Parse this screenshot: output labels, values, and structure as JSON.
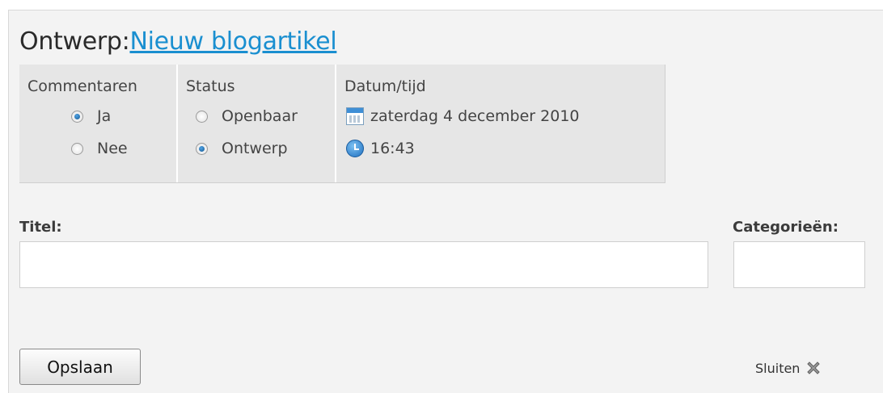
{
  "heading": {
    "prefix": "Ontwerp:",
    "link": "Nieuw blogartikel"
  },
  "options": {
    "comments": {
      "title": "Commentaren",
      "yes": "Ja",
      "no": "Nee",
      "selected": "Ja"
    },
    "status": {
      "title": "Status",
      "public": "Openbaar",
      "draft": "Ontwerp",
      "selected": "Ontwerp"
    },
    "datetime": {
      "title": "Datum/tijd",
      "date": "zaterdag 4 december 2010",
      "time": "16:43"
    }
  },
  "form": {
    "title_label": "Titel:",
    "title_value": "",
    "categories_label": "Categorieën:",
    "categories_value": ""
  },
  "actions": {
    "save": "Opslaan",
    "close": "Sluiten"
  },
  "icons": {
    "calendar": "calendar-icon",
    "clock": "clock-icon",
    "close": "close-icon"
  },
  "colors": {
    "link": "#1a8fd0",
    "panel": "#f3f3f3",
    "option_box": "#e6e6e6",
    "radio_checked": "#1f6fbf"
  }
}
